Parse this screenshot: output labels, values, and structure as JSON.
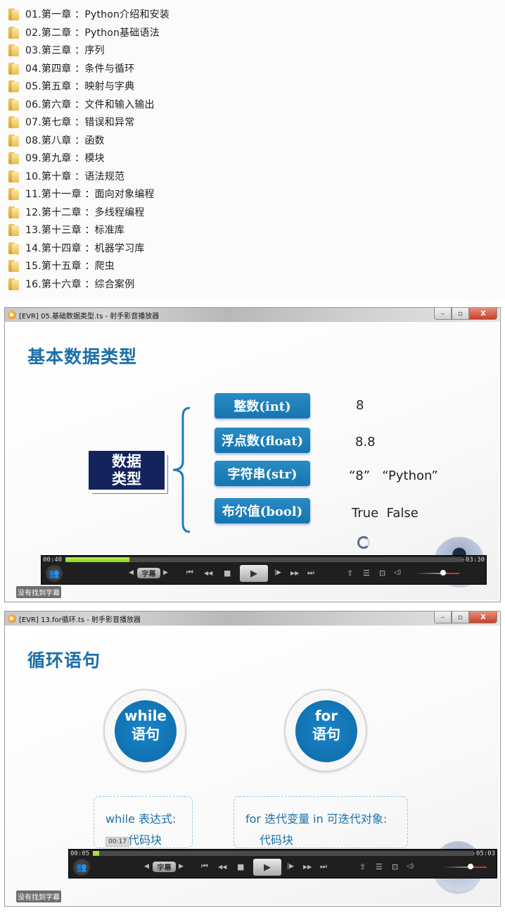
{
  "folder_list": {
    "items": [
      {
        "label": "01.第一章 ：Python介绍和安装"
      },
      {
        "label": "02.第二章 ：Python基础语法"
      },
      {
        "label": "03.第三章 ：序列"
      },
      {
        "label": "04.第四章 ：条件与循环"
      },
      {
        "label": "05.第五章 ：映射与字典"
      },
      {
        "label": "06.第六章 ：文件和输入输出"
      },
      {
        "label": "07.第七章 ：错误和异常"
      },
      {
        "label": "08.第八章 ：函数"
      },
      {
        "label": "09.第九章 ：模块"
      },
      {
        "label": "10.第十章 ：语法规范"
      },
      {
        "label": "11.第十一章 ：面向对象编程"
      },
      {
        "label": "12.第十二章 ：多线程编程"
      },
      {
        "label": "13.第十三章 ：标准库"
      },
      {
        "label": "14.第十四章 ：机器学习库"
      },
      {
        "label": "15.第十五章 ：爬虫"
      },
      {
        "label": "16.第十六章 ：综合案例"
      }
    ]
  },
  "players": [
    {
      "window_title": "[EVR] 05.基础数据类型.ts - 射手影音播放器",
      "window_buttons": {
        "minimize": "–",
        "maximize": "▫",
        "close": "X"
      },
      "slide": {
        "title": "基本数据类型",
        "category_label_line1": "数据",
        "category_label_line2": "类型",
        "types": [
          {
            "label": "整数(int)",
            "example": "8"
          },
          {
            "label": "浮点数(float)",
            "example": "8.8"
          },
          {
            "label": "字符串(str)",
            "example": "“8”   “Python”"
          },
          {
            "label": "布尔值(bool)",
            "example": "True  False"
          }
        ]
      },
      "controls": {
        "time_current": "00:40",
        "time_remaining": "-03:30",
        "progress_fraction": 0.16,
        "volume_fraction": 0.62,
        "subtitle_label": "字幕"
      },
      "status_text": "没有找到字幕"
    },
    {
      "window_title": "[EVR] 13.for循环.ts - 射手影音播放器",
      "window_buttons": {
        "minimize": "–",
        "maximize": "▫",
        "close": "X"
      },
      "slide": {
        "title": "循环语句",
        "loops": [
          {
            "line1": "while",
            "line2": "语句",
            "code_line1": "while 表达式:",
            "code_line2": "代码块"
          },
          {
            "line1": "for",
            "line2": "语句",
            "code_line1": "for 迭代变量 in 可迭代对象:",
            "code_line2": "代码块"
          }
        ],
        "hover_time": "00:17"
      },
      "controls": {
        "time_current": "00:05",
        "time_remaining": "-05:03",
        "progress_fraction": 0.016,
        "volume_fraction": 0.62,
        "subtitle_label": "字幕"
      },
      "status_text": "没有找到字幕"
    }
  ],
  "control_icons": {
    "people": "👥",
    "prev_sub": "◀",
    "next_sub": "▶",
    "skip_back": "⏮",
    "rewind": "◀◀",
    "stop": "■",
    "play": "▶",
    "step": "|▶",
    "fast_forward": "▶▶",
    "skip_forward": "⏭",
    "open": "⇪",
    "playlist": "☰",
    "settings": "⊡",
    "volume": "◁)"
  }
}
